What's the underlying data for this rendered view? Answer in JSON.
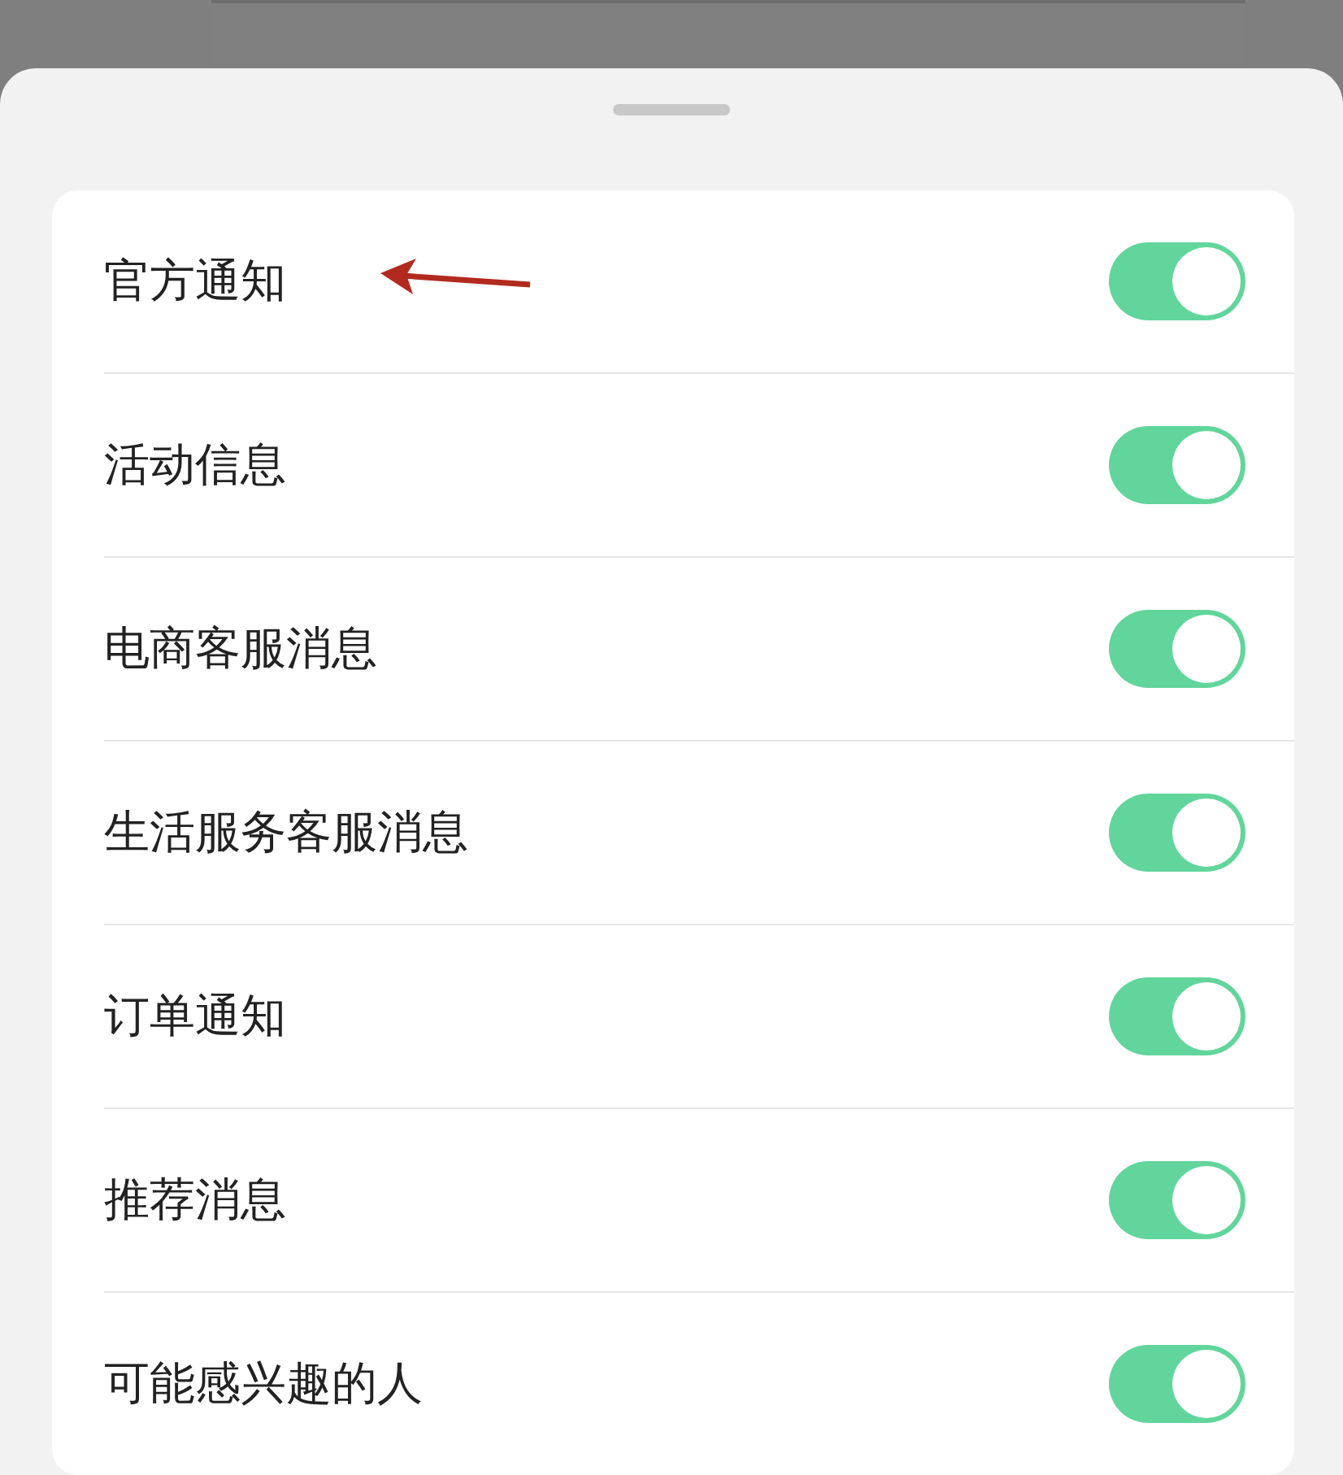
{
  "settings": [
    {
      "label": "官方通知",
      "on": true,
      "annotated": true
    },
    {
      "label": "活动信息",
      "on": true,
      "annotated": false
    },
    {
      "label": "电商客服消息",
      "on": true,
      "annotated": false
    },
    {
      "label": "生活服务客服消息",
      "on": true,
      "annotated": false
    },
    {
      "label": "订单通知",
      "on": true,
      "annotated": false
    },
    {
      "label": "推荐消息",
      "on": true,
      "annotated": false
    },
    {
      "label": "可能感兴趣的人",
      "on": true,
      "annotated": false
    }
  ]
}
